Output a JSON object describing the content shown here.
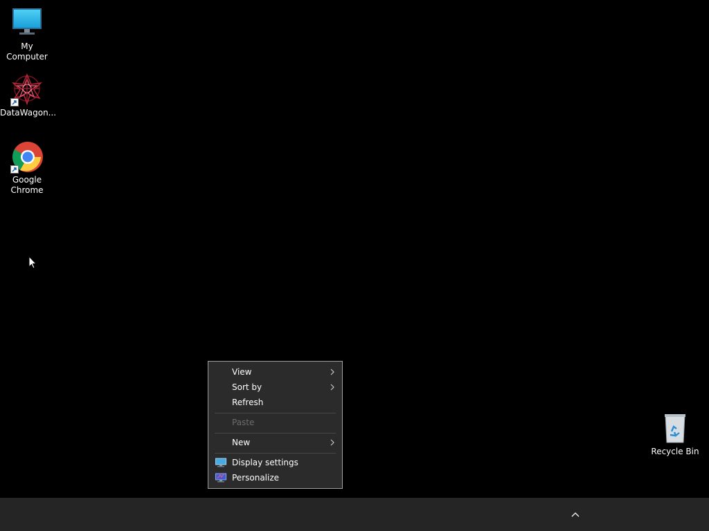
{
  "desktop": {
    "background_color": "#000000",
    "icons": [
      {
        "id": "my-computer",
        "label": "My Computer",
        "icon": "monitor-icon"
      },
      {
        "id": "datawagon",
        "label": "DataWagon...",
        "icon": "datawagon-icon",
        "shortcut": true
      },
      {
        "id": "google-chrome",
        "label": "Google Chrome",
        "icon": "chrome-icon",
        "shortcut": true
      },
      {
        "id": "recycle-bin",
        "label": "Recycle Bin",
        "icon": "recycle-bin-icon"
      }
    ]
  },
  "context_menu": {
    "items": [
      {
        "label": "View",
        "submenu": true,
        "enabled": true
      },
      {
        "label": "Sort by",
        "submenu": true,
        "enabled": true
      },
      {
        "label": "Refresh",
        "submenu": false,
        "enabled": true
      },
      {
        "label": "Paste",
        "submenu": false,
        "enabled": false
      },
      {
        "label": "New",
        "submenu": true,
        "enabled": true
      },
      {
        "label": "Display settings",
        "submenu": false,
        "enabled": true,
        "icon": "display-settings-icon"
      },
      {
        "label": "Personalize",
        "submenu": false,
        "enabled": true,
        "icon": "personalize-icon"
      }
    ]
  },
  "taskbar": {
    "background_color": "#252525",
    "tray_icon": "chevron-up-icon"
  },
  "colors": {
    "menu_background": "#2b2b2b",
    "menu_border": "#a0a0a0",
    "disabled_text": "#6d6d6d"
  }
}
